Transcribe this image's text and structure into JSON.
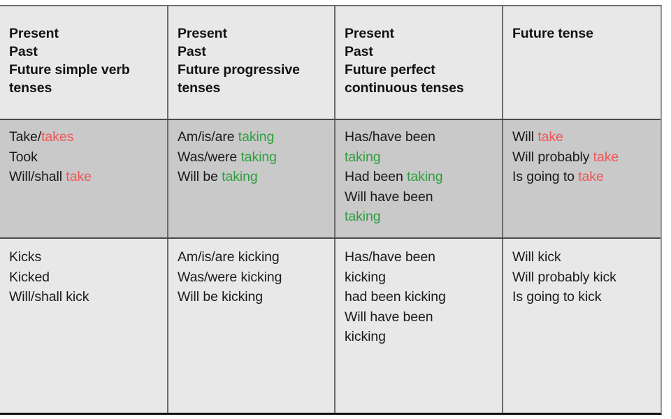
{
  "table": {
    "columns": [
      {
        "id": "simple",
        "header_lines": [
          "Present",
          "Past",
          "Future simple verb tenses"
        ]
      },
      {
        "id": "progressive",
        "header_lines": [
          "Present",
          "Past",
          "Future progressive tenses"
        ]
      },
      {
        "id": "perfect-continuous",
        "header_lines": [
          "Present",
          "Past",
          "Future perfect continuous tenses"
        ]
      },
      {
        "id": "future",
        "header_lines": [
          "Future tense"
        ]
      }
    ],
    "rows": [
      {
        "id": "take",
        "shaded": true,
        "cells": [
          {
            "lines": [
              [
                {
                  "t": "Take/",
                  "c": "black"
                },
                {
                  "t": "takes",
                  "c": "red"
                }
              ],
              [
                {
                  "t": "Took",
                  "c": "black"
                }
              ],
              [
                {
                  "t": "Will/shall ",
                  "c": "black"
                },
                {
                  "t": "take",
                  "c": "red"
                }
              ]
            ]
          },
          {
            "lines": [
              [
                {
                  "t": "Am/is/are ",
                  "c": "black"
                },
                {
                  "t": "taking",
                  "c": "green"
                }
              ],
              [
                {
                  "t": "Was/were ",
                  "c": "black"
                },
                {
                  "t": "taking",
                  "c": "green"
                }
              ],
              [
                {
                  "t": "Will be ",
                  "c": "black"
                },
                {
                  "t": "taking",
                  "c": "green"
                }
              ]
            ]
          },
          {
            "lines": [
              [
                {
                  "t": "Has/have been",
                  "c": "black"
                }
              ],
              [
                {
                  "t": "taking",
                  "c": "green"
                }
              ],
              [
                {
                  "t": "Had been ",
                  "c": "black"
                },
                {
                  "t": "taking",
                  "c": "green"
                }
              ],
              [
                {
                  "t": "Will have been",
                  "c": "black"
                }
              ],
              [
                {
                  "t": "taking",
                  "c": "green"
                }
              ]
            ]
          },
          {
            "lines": [
              [
                {
                  "t": "Will ",
                  "c": "black"
                },
                {
                  "t": "take",
                  "c": "red"
                }
              ],
              [
                {
                  "t": "Will probably ",
                  "c": "black"
                },
                {
                  "t": "take",
                  "c": "red"
                }
              ],
              [
                {
                  "t": "Is going to ",
                  "c": "black"
                },
                {
                  "t": "take",
                  "c": "red"
                }
              ]
            ]
          }
        ]
      },
      {
        "id": "kick",
        "shaded": false,
        "cells": [
          {
            "lines": [
              [
                {
                  "t": "Kicks",
                  "c": "black"
                }
              ],
              [
                {
                  "t": "Kicked",
                  "c": "black"
                }
              ],
              [
                {
                  "t": "Will/shall kick",
                  "c": "black"
                }
              ]
            ]
          },
          {
            "lines": [
              [
                {
                  "t": "Am/is/are kicking",
                  "c": "black"
                }
              ],
              [
                {
                  "t": "Was/were kicking",
                  "c": "black"
                }
              ],
              [
                {
                  "t": "Will be kicking",
                  "c": "black"
                }
              ]
            ]
          },
          {
            "lines": [
              [
                {
                  "t": "Has/have been",
                  "c": "black"
                }
              ],
              [
                {
                  "t": "kicking",
                  "c": "black"
                }
              ],
              [
                {
                  "t": "had been kicking",
                  "c": "black"
                }
              ],
              [
                {
                  "t": "Will have been",
                  "c": "black"
                }
              ],
              [
                {
                  "t": "kicking",
                  "c": "black"
                }
              ]
            ]
          },
          {
            "lines": [
              [
                {
                  "t": "Will kick",
                  "c": "black"
                }
              ],
              [
                {
                  "t": "Will probably kick",
                  "c": "black"
                }
              ],
              [
                {
                  "t": "Is going to kick",
                  "c": "black"
                }
              ]
            ]
          }
        ]
      }
    ]
  },
  "colors": {
    "highlight_red": "#f05555",
    "highlight_green": "#2f9e3f",
    "text": "#1a1a1a",
    "header_text": "#121212",
    "row_shaded_bg": "#c9c9c9",
    "row_plain_bg": "#e8e8e8",
    "header_bg": "#e8e8e8",
    "grid_line": "#6b6b6b"
  }
}
